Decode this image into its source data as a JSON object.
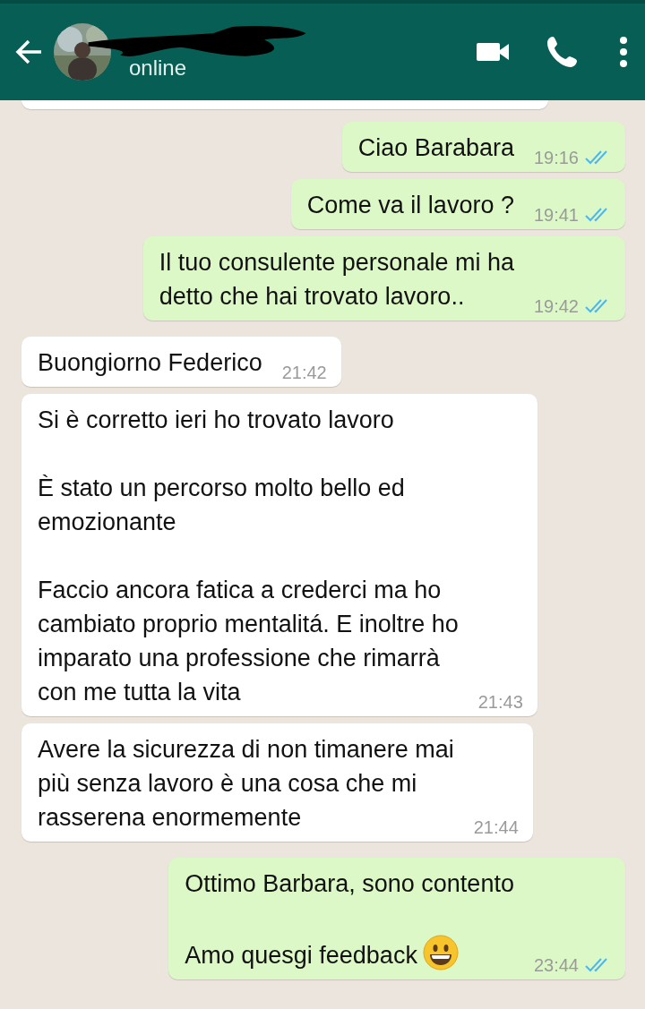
{
  "header": {
    "status": "online"
  },
  "messages": [
    {
      "kind": "out",
      "text": "Ciao Barabara",
      "time": "19:16",
      "read": true
    },
    {
      "kind": "out",
      "text": "Come va il lavoro ?",
      "time": "19:41",
      "read": true
    },
    {
      "kind": "out",
      "text": "Il tuo consulente personale mi ha\ndetto che hai trovato lavoro..",
      "time": "19:42",
      "read": true
    },
    {
      "kind": "in",
      "text": "Buongiorno Federico",
      "time": "21:42"
    },
    {
      "kind": "in",
      "text": "Si è corretto ieri ho trovato lavoro\n\nÈ stato un percorso molto bello ed\nemozionante\n\nFaccio ancora fatica a crederci ma ho\ncambiato proprio mentalitá. E inoltre ho\nimparato una professione che rimarrà\ncon me tutta la vita",
      "time": "21:43"
    },
    {
      "kind": "in",
      "text": "Avere la sicurezza di non timanere mai\npiù senza lavoro è una cosa che mi\nrasserena enormemente",
      "time": "21:44"
    },
    {
      "kind": "out",
      "text": "Ottimo Barbara, sono contento\n\nAmo quesgi feedback",
      "time": "23:44",
      "read": true,
      "emoji": true
    }
  ]
}
